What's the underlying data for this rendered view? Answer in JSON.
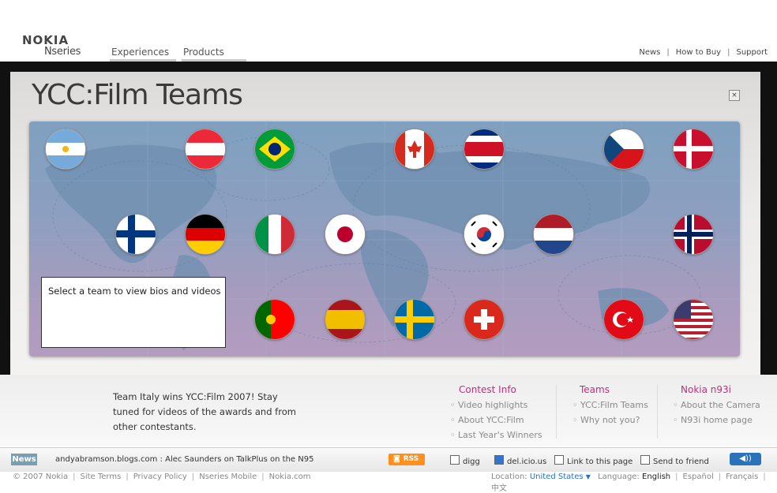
{
  "brand": {
    "nokia": "NOKIA",
    "nseries": "Nseries"
  },
  "nav": {
    "tabs": [
      "Experiences",
      "Products"
    ]
  },
  "top_links": [
    "News",
    "How to Buy",
    "Support"
  ],
  "panel": {
    "title": "YCC:Film Teams",
    "close": "×",
    "info_text": "Select a team to view bios and videos"
  },
  "flags": [
    "argentina",
    "austria",
    "brazil",
    "canada",
    "costa-rica",
    "czech-republic",
    "denmark",
    "finland",
    "germany",
    "italy",
    "japan",
    "south-korea",
    "netherlands",
    "norway",
    "portugal",
    "spain",
    "sweden",
    "switzerland",
    "turkey",
    "usa"
  ],
  "news_blurb": "Team Italy wins YCC:Film 2007! Stay tuned for videos of the awards and from other contestants.",
  "columns": [
    {
      "heading": "Contest Info",
      "items": [
        "Video highlights",
        "About YCC:Film",
        "Last Year's Winners"
      ]
    },
    {
      "heading": "Teams",
      "items": [
        "YCC:Film Teams",
        "Why not you?"
      ]
    },
    {
      "heading": "Nokia n93i",
      "items": [
        "About the Camera",
        "N93i home page"
      ]
    }
  ],
  "bottom_bar": {
    "news_badge": "News",
    "ticker": "andyabramson.blogs.com : Alec Saunders on TalkPlus on the N95",
    "rss": "RSS",
    "social": [
      "digg",
      "del.icio.us",
      "Link to this page",
      "Send to friend"
    ],
    "sound_icon": "speaker-icon"
  },
  "footer": {
    "copyright": "© 2007 Nokia",
    "links": [
      "Site Terms",
      "Privacy Policy",
      "Nseries Mobile",
      "Nokia.com"
    ],
    "location_label": "Location:",
    "location_value": "United States",
    "language_label": "Language:",
    "languages": [
      "English",
      "Español",
      "Français",
      "中文"
    ]
  },
  "colors": {
    "accent_pink": "#c22d7a",
    "link_blue": "#2c72ba",
    "rss_orange": "#ff8f1e"
  }
}
